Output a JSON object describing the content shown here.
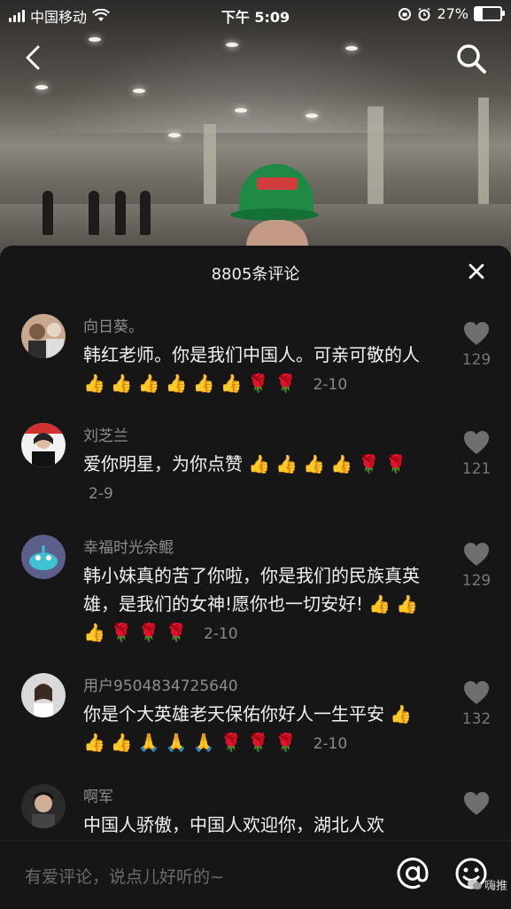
{
  "status_bar": {
    "carrier": "中国移动",
    "time": "下午 5:09",
    "battery": "27%",
    "battery_level": 0.27
  },
  "comments_sheet": {
    "title": "8805条评论",
    "comments": [
      {
        "username": "向日葵。",
        "text": "韩红老师。你是我们中国人。可亲可敬的人",
        "emojis": "👍👍👍👍👍👍🌹🌹",
        "date": "2-10",
        "likes": "129"
      },
      {
        "username": "刘芝兰",
        "text": "爱你明星，为你点赞",
        "emojis": "👍👍👍👍🌹🌹",
        "date": "2-9",
        "likes": "121"
      },
      {
        "username": "幸福时光余鲲",
        "text": "韩小妹真的苦了你啦，你是我们的民族真英雄，是我们的女神!愿你也一切安好!",
        "emojis": "👍👍👍🌹🌹🌹",
        "date": "2-10",
        "likes": "129"
      },
      {
        "username": "用户9504834725640",
        "text": "你是个大英雄老天保佑你好人一生平安",
        "emojis": "👍👍👍🙏🙏🙏🌹🌹🌹",
        "date": "2-10",
        "likes": "132"
      },
      {
        "username": "啊军",
        "text": "中国人骄傲，中国人欢迎你，湖北人欢",
        "emojis": "",
        "date": "",
        "likes": ""
      }
    ]
  },
  "input_bar": {
    "placeholder": "有爱评论，说点儿好听的~",
    "watermark": "嗨推"
  },
  "colors": {
    "sheet_bg": "#161616",
    "muted_text": "#8d8d8d",
    "cap_green": "#1f8a45"
  }
}
